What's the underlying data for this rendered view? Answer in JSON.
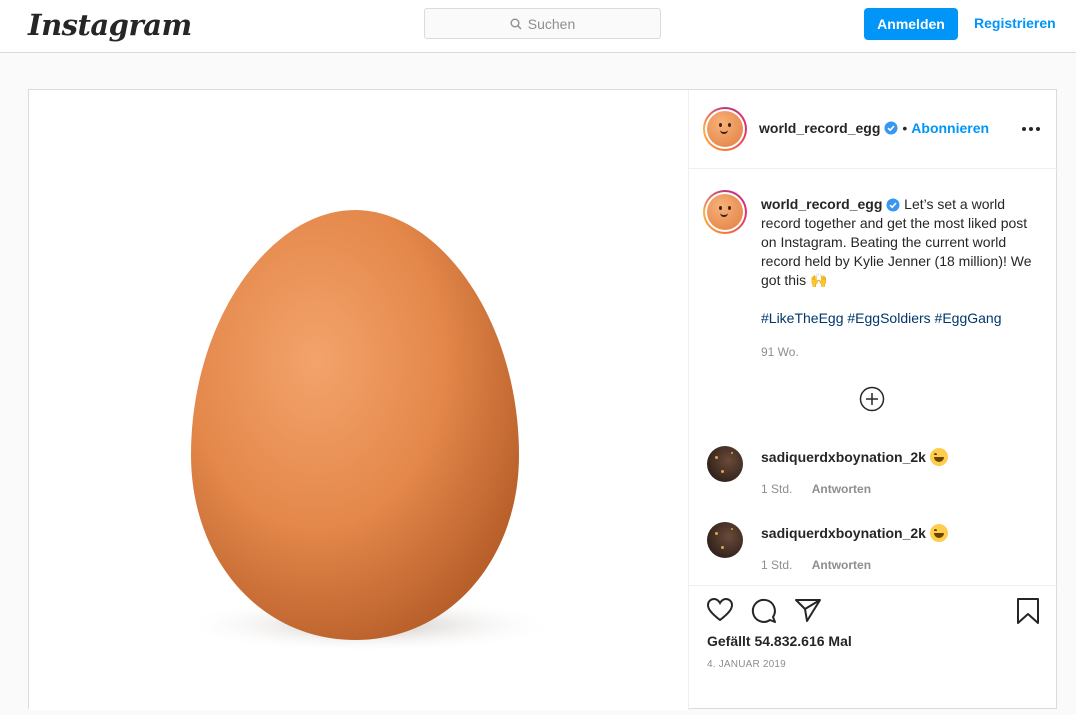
{
  "topbar": {
    "logo": "Instagram",
    "search_placeholder": "Suchen",
    "login_label": "Anmelden",
    "register_label": "Registrieren"
  },
  "post": {
    "username": "world_record_egg",
    "verified": true,
    "follow_label": "Abonnieren",
    "caption": "Let’s set a world record together and get the most liked post on Instagram. Beating the current world record held by Kylie Jenner (18 million)! We got this 🙌",
    "hashtags": "#LikeTheEgg #EggSoldiers #EggGang",
    "age": "91 Wo.",
    "likes": "Gefällt 54.832.616 Mal",
    "date": "4. JANUAR 2019"
  },
  "comments": [
    {
      "username": "sadiquerdxboynation_2k",
      "emoji": "😂",
      "time": "1 Std.",
      "reply_label": "Antworten"
    },
    {
      "username": "sadiquerdxboynation_2k",
      "emoji": "😂",
      "time": "1 Std.",
      "reply_label": "Antworten"
    }
  ],
  "icons": {
    "search": "search-icon",
    "verified": "verified-badge-icon",
    "more": "more-options-icon",
    "load_more": "plus-circle-icon",
    "like": "heart-icon",
    "comment": "comment-icon",
    "share": "share-icon",
    "save": "bookmark-icon"
  },
  "colors": {
    "accent": "#0095f6",
    "hashtag": "#00376b",
    "muted": "#8e8e8e",
    "verified": "#3897f0"
  }
}
